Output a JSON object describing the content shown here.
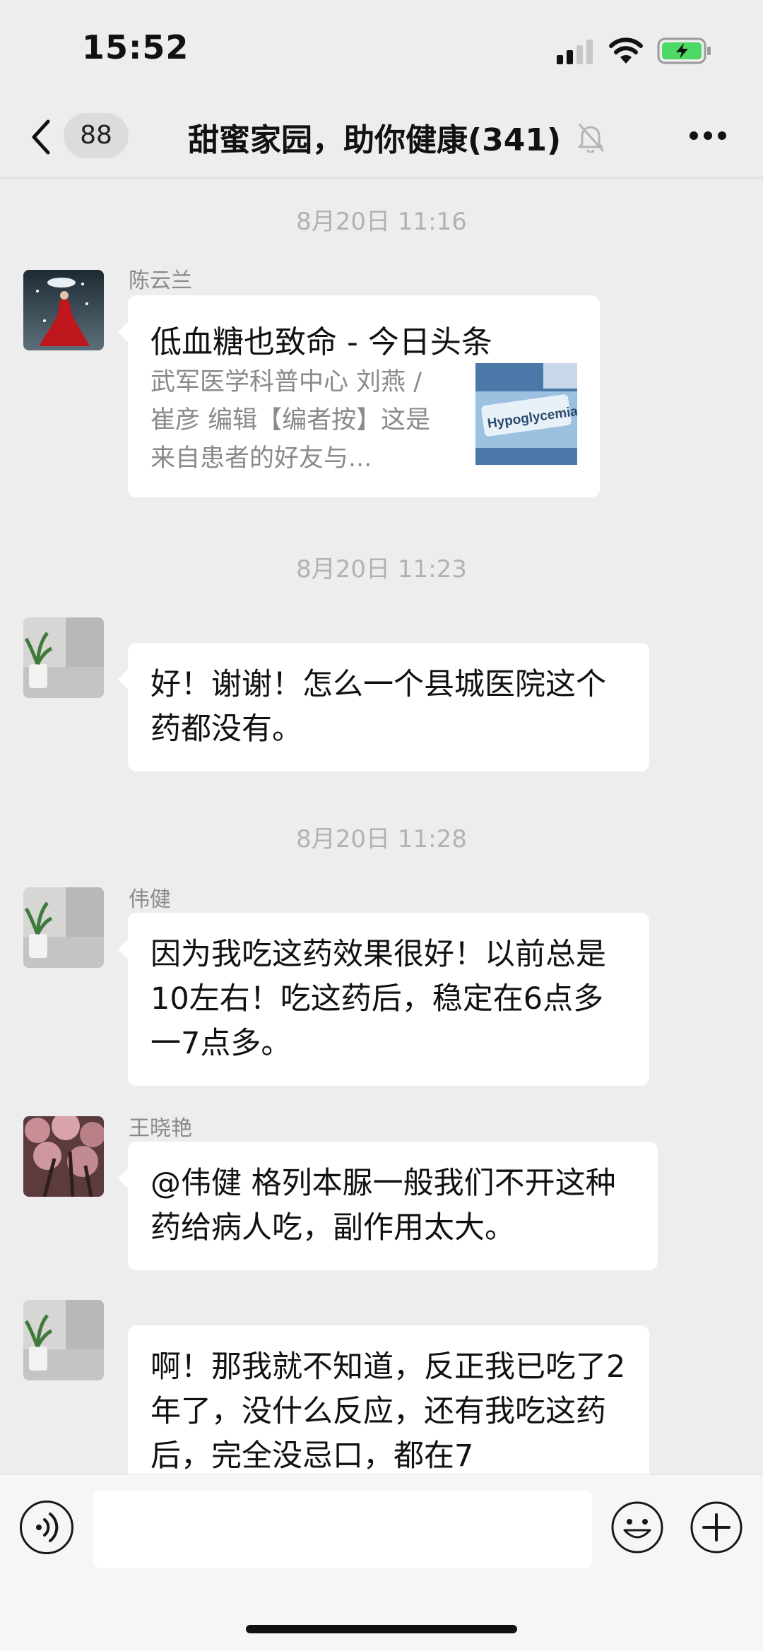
{
  "status_bar": {
    "time": "15:52"
  },
  "nav": {
    "unread_count": "88",
    "title": "甜蜜家园，助你健康(341)"
  },
  "messages": [
    {
      "timestamp": "8月20日 11:16",
      "sender": "陈云兰",
      "type": "link",
      "card_title": "低血糖也致命 - 今日头条",
      "card_desc": "武军医学科普中心 刘燕 / 崔彦 编辑【编者按】这是来自患者的好友与...",
      "thumb_text": "Hypoglycemia"
    },
    {
      "timestamp": "8月20日 11:23",
      "sender": "",
      "type": "text",
      "text": "好！谢谢！怎么一个县城医院这个药都没有。"
    },
    {
      "timestamp": "8月20日 11:28",
      "sender": "伟健",
      "type": "text",
      "text": "因为我吃这药效果很好！以前总是10左右！吃这药后，稳定在6点多一7点多。"
    },
    {
      "sender": "王晓艳",
      "type": "text",
      "text": "@伟健 格列本脲一般我们不开这种药给病人吃，副作用太大。"
    },
    {
      "sender": "",
      "type": "text",
      "text": "啊！那我就不知道，反正我已吃了2年了，没什么反应，还有我吃这药后，完全没忌口，都在7"
    }
  ],
  "colors": {
    "background": "#ededed",
    "bubble": "#ffffff",
    "timestamp": "#b2b2b2",
    "battery": "#4cd964"
  },
  "icons": [
    "signal-icon",
    "wifi-icon",
    "battery-icon",
    "back-icon",
    "mute-icon",
    "more-icon",
    "voice-icon",
    "emoji-icon",
    "plus-icon"
  ]
}
